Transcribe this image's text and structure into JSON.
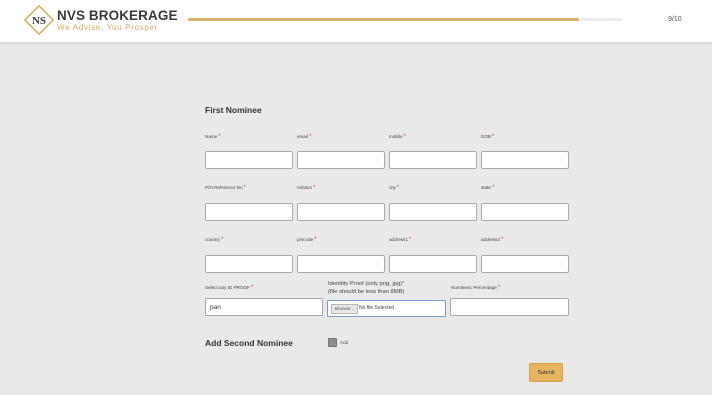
{
  "header": {
    "brand": "NVS BROKERAGE",
    "tagline": "We Advise, You Prosper",
    "logo_initials": "NS",
    "step": "9/10",
    "progress": 0.9
  },
  "form": {
    "first_nominee_title": "First Nominee",
    "fields": {
      "name": {
        "label": "Name",
        "value": ""
      },
      "email": {
        "label": "email",
        "value": ""
      },
      "mobile": {
        "label": "mobile",
        "value": ""
      },
      "dob": {
        "label": "DOB",
        "value": ""
      },
      "poi_reference": {
        "label": "POI Reference No",
        "value": ""
      },
      "relation": {
        "label": "relation",
        "value": ""
      },
      "city": {
        "label": "city",
        "value": ""
      },
      "state": {
        "label": "state",
        "value": ""
      },
      "country": {
        "label": "country",
        "value": ""
      },
      "pincode": {
        "label": "pincode",
        "value": ""
      },
      "address1": {
        "label": "address1",
        "value": ""
      },
      "address2": {
        "label": "address2",
        "value": ""
      },
      "id_proof": {
        "label": "Select any ID PROOF",
        "value": "pan"
      },
      "identity_proof": {
        "label_line1": "Identtity Proof (only png, jpg)",
        "label_line2": "(file should be less than 8MB)",
        "browse_label": "Browse...",
        "file_status": "No file Selected"
      },
      "nominee_percentage": {
        "label": "Nominee1 Percentage",
        "value": ""
      }
    },
    "required_marker": "*",
    "second_nominee_title": "Add Second Nominee",
    "second_nominee_checkbox_label": "Add",
    "submit_label": "Submit"
  },
  "colors": {
    "accent": "#d8b26a",
    "submit": "#e7b560",
    "required": "#e0413e",
    "background": "#e9e9e9"
  }
}
